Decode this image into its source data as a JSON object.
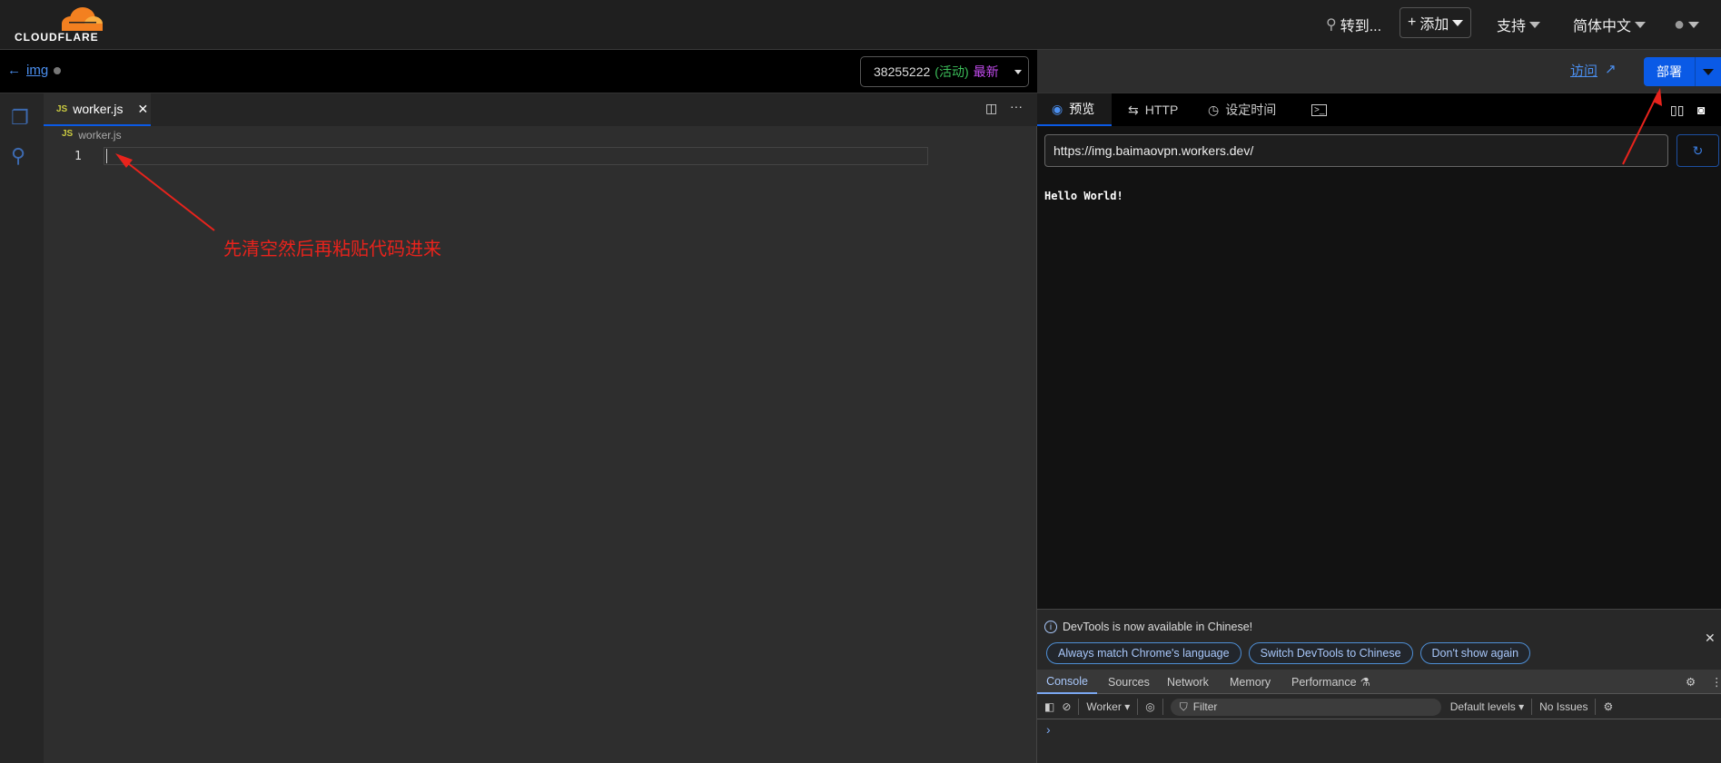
{
  "brand": {
    "name": "CLOUDFLARE",
    "accent": "#f38020"
  },
  "topnav": {
    "search": "转到...",
    "add": "添加",
    "support": "支持",
    "language": "简体中文"
  },
  "worker": {
    "back_label": "img",
    "version_id": "38255222",
    "version_status": "(活动)",
    "version_tag": "最新"
  },
  "actions": {
    "visit": "访问",
    "deploy": "部署",
    "deploy_color": "#0a5ae6"
  },
  "editor": {
    "tab": "worker.js",
    "breadcrumb": "worker.js",
    "line_numbers": [
      "1"
    ],
    "file_badge": "JS"
  },
  "preview": {
    "tabs": [
      {
        "label": "预览",
        "icon": "eye-icon"
      },
      {
        "label": "HTTP",
        "icon": "arrows-icon"
      },
      {
        "label": "设定时间",
        "icon": "clock-icon"
      },
      {
        "label": "",
        "icon": "terminal-icon"
      }
    ],
    "url": "https://img.baimaovpn.workers.dev/",
    "output": "Hello World!"
  },
  "devtools": {
    "notice": "DevTools is now available in Chinese!",
    "buttons": [
      "Always match Chrome's language",
      "Switch DevTools to Chinese",
      "Don't show again"
    ],
    "tabs": [
      "Console",
      "Sources",
      "Network",
      "Memory",
      "Performance"
    ],
    "context": "Worker",
    "filter_placeholder": "Filter",
    "levels": "Default levels",
    "issues": "No Issues",
    "prompt": "›"
  },
  "annotation": {
    "text": "先清空然后再粘贴代码进来",
    "color": "#e8231c"
  }
}
